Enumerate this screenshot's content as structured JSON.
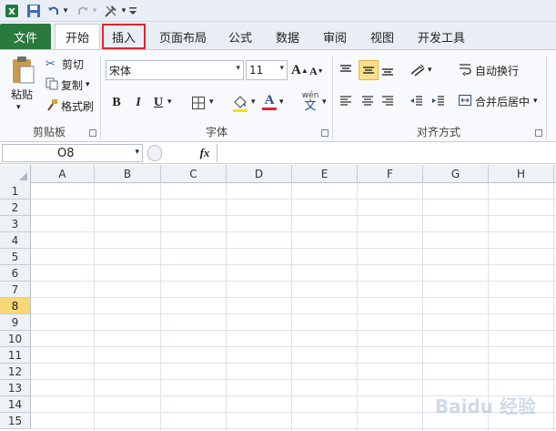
{
  "qat": {
    "dropdown_glyph": "▾"
  },
  "tabs": {
    "file": "文件",
    "items": [
      "开始",
      "插入",
      "页面布局",
      "公式",
      "数据",
      "审阅",
      "视图",
      "开发工具"
    ]
  },
  "clipboard": {
    "paste": "粘贴",
    "cut": "剪切",
    "copy": "复制",
    "format_painter": "格式刷",
    "group": "剪贴板"
  },
  "font": {
    "name": "宋体",
    "size": "11",
    "bold": "B",
    "italic": "I",
    "underline": "U",
    "wen": "wén",
    "wen_char": "文",
    "group": "字体"
  },
  "alignment": {
    "wrap": "自动换行",
    "merge": "合并后居中",
    "group": "对齐方式"
  },
  "formula_bar": {
    "cell_ref": "O8",
    "fx": "fx"
  },
  "grid": {
    "columns": [
      "A",
      "B",
      "C",
      "D",
      "E",
      "F",
      "G",
      "H"
    ],
    "rows": [
      "1",
      "2",
      "3",
      "4",
      "5",
      "6",
      "7",
      "8",
      "9",
      "10",
      "11",
      "12",
      "13",
      "14",
      "15"
    ],
    "selected_row": "8"
  },
  "watermark": "Baidu 经验",
  "colors": {
    "file_tab": "#2a7a3e",
    "highlight": "#e0262b",
    "selected_header": "#f8d776"
  }
}
